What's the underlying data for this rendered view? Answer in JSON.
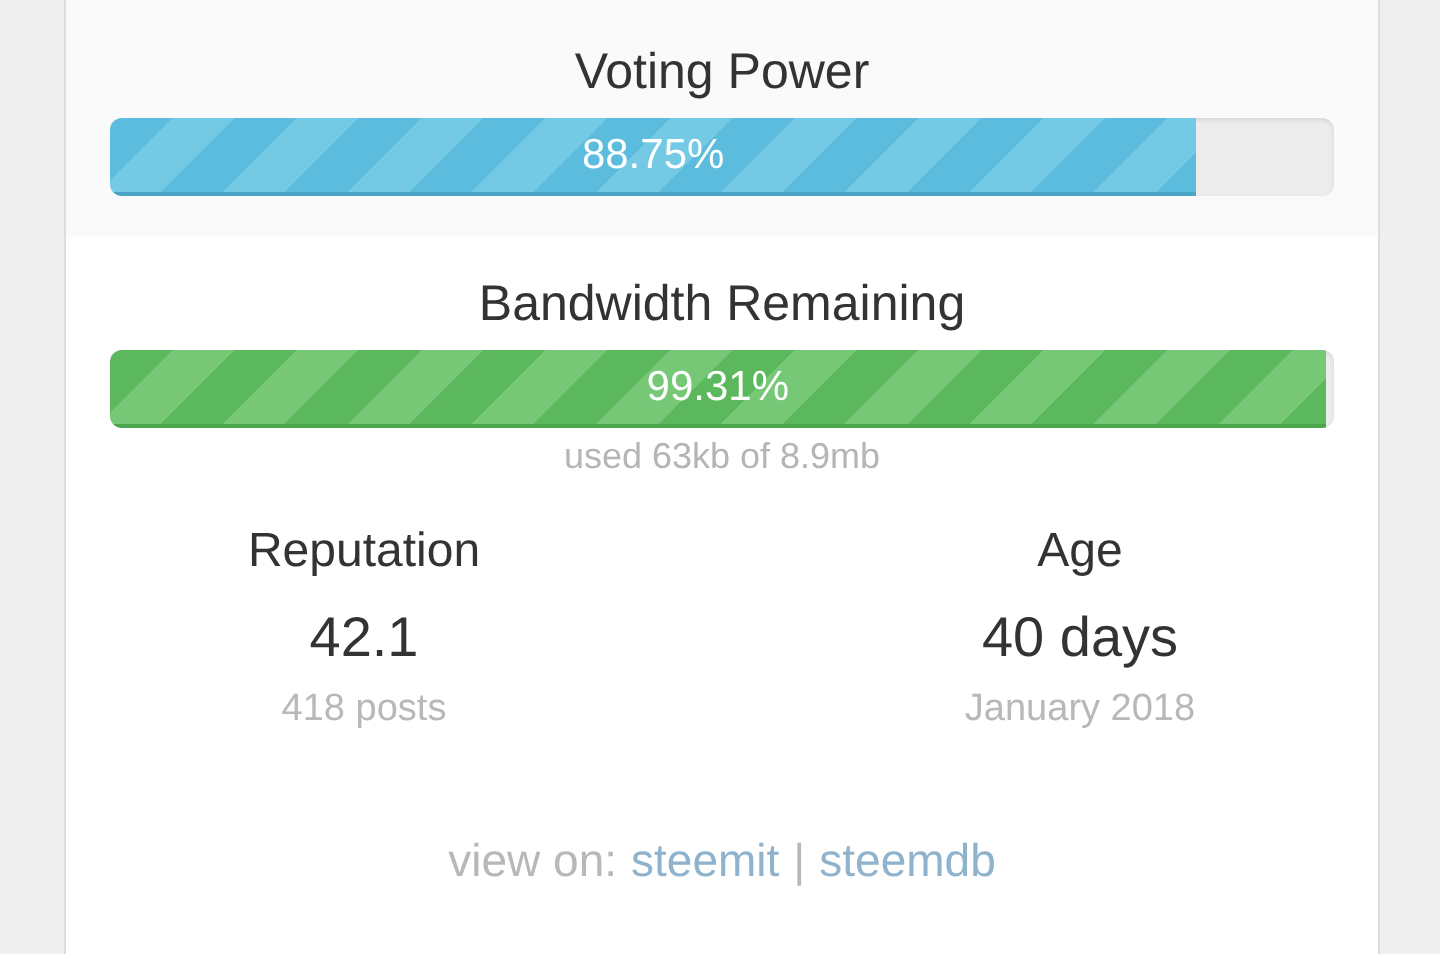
{
  "meters": [
    {
      "title": "Voting Power",
      "kind": "blue",
      "level": 0.8875,
      "reading": "88.75%"
    },
    {
      "title": "Bandwidth Remaining",
      "kind": "green",
      "level": 0.9931,
      "reading": "99.31%",
      "note": "used 63kb of 8.9mb"
    }
  ],
  "stats": [
    {
      "label": "Reputation",
      "value": "42.1",
      "sub": "418 posts"
    },
    {
      "label": "Age",
      "value": "40 days",
      "sub": "January 2018"
    }
  ],
  "view_on": {
    "label": "view on:",
    "links": [
      "steemit",
      "steemdb"
    ],
    "separator": "|"
  }
}
